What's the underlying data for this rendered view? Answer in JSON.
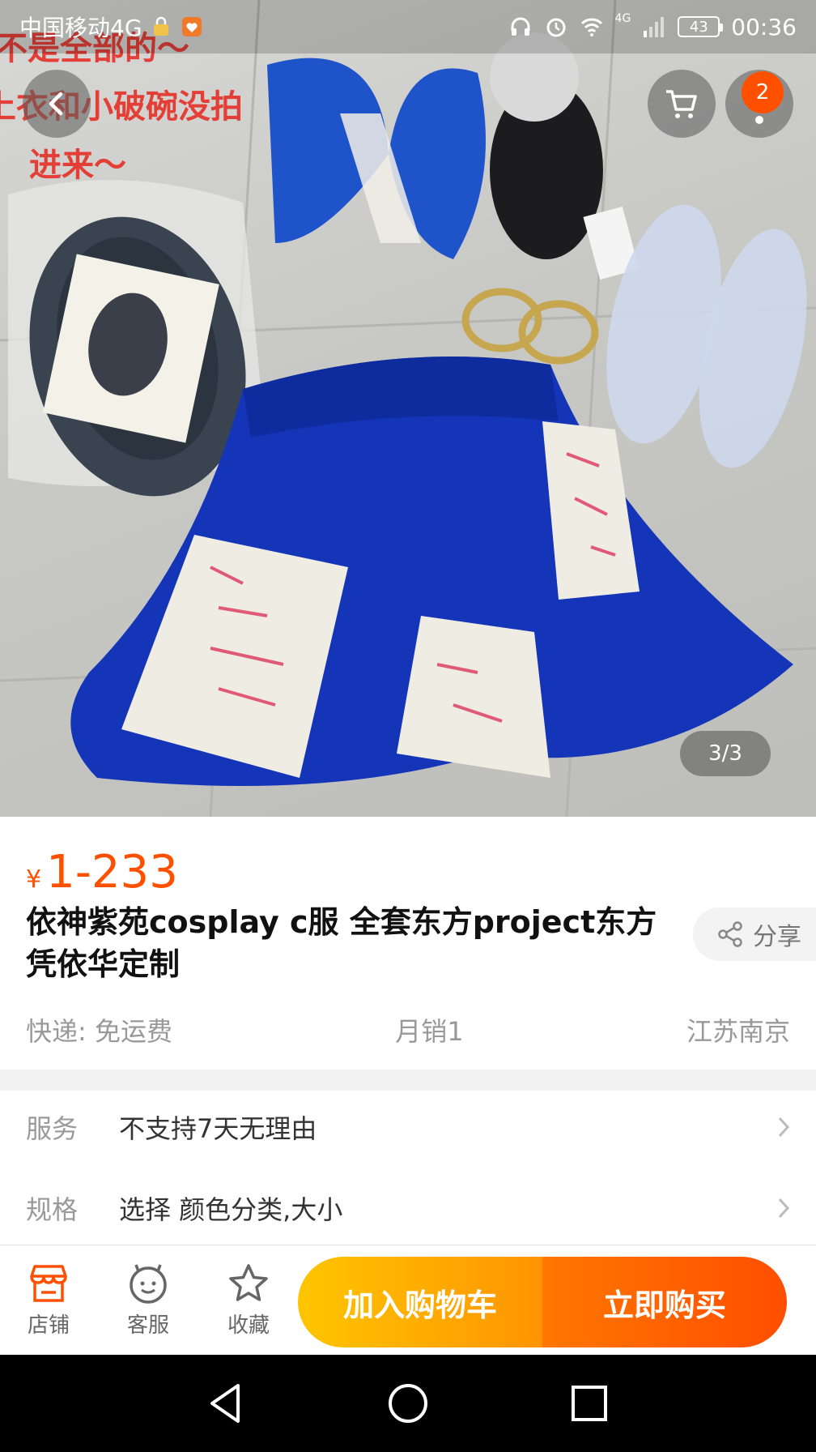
{
  "status_bar": {
    "carrier": "中国移动4G",
    "network": "4G",
    "battery": "43",
    "time": "00:36"
  },
  "photo_overlay": {
    "line1": "不是全部的～",
    "line2": "上衣和小破碗没拍",
    "line3": "进来～"
  },
  "header": {
    "cart_badge": "2"
  },
  "gallery": {
    "pagination": "3/3"
  },
  "product": {
    "currency": "¥",
    "price": "1-233",
    "title": "依神紫苑cosplay c服 全套东方project东方凭依华定制",
    "share_label": "分享",
    "shipping": "快递: 免运费",
    "monthly_sales": "月销1",
    "location": "江苏南京"
  },
  "options": [
    {
      "label": "服务",
      "value": "不支持7天无理由"
    },
    {
      "label": "规格",
      "value": "选择 颜色分类,大小"
    }
  ],
  "action_bar": {
    "shop": "店铺",
    "service": "客服",
    "favorite": "收藏",
    "add_to_cart": "加入购物车",
    "buy_now": "立即购买"
  },
  "colors": {
    "accent": "#ff5000",
    "cart_button": "#ffb000",
    "buy_button": "#ff5a00"
  }
}
